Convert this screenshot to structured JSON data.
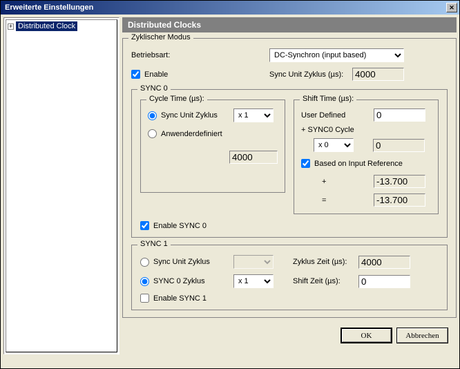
{
  "window": {
    "title": "Erweiterte Einstellungen",
    "close": "✕"
  },
  "tree": {
    "item": "Distributed Clock"
  },
  "header": "Distributed Clocks",
  "zyklisch": {
    "title": "Zyklischer Modus",
    "betriebsart_label": "Betriebsart:",
    "betriebsart_value": "DC-Synchron (input based)",
    "enable_label": "Enable",
    "sync_unit_label": "Sync Unit Zyklus (µs):",
    "sync_unit_value": "4000"
  },
  "sync0": {
    "title": "SYNC 0",
    "cycle_time": {
      "title": "Cycle Time (µs):",
      "radio_sync_unit": "Sync Unit Zyklus",
      "mult": "x 1",
      "radio_user": "Anwenderdefiniert",
      "value": "4000"
    },
    "shift_time": {
      "title": "Shift Time (µs):",
      "user_defined": "User Defined",
      "user_defined_val": "0",
      "plus_sync0": "+ SYNC0 Cycle",
      "mult": "x 0",
      "mult_val": "0",
      "based_on": "Based on Input Reference",
      "plus": "+",
      "plus_val": "-13.700",
      "eq": "=",
      "eq_val": "-13.700"
    },
    "enable_label": "Enable SYNC 0"
  },
  "sync1": {
    "title": "SYNC 1",
    "radio_sync_unit": "Sync Unit Zyklus",
    "radio_sync0": "SYNC 0 Zyklus",
    "mult": "x 1",
    "zyklus_label": "Zyklus Zeit (µs):",
    "zyklus_val": "4000",
    "shift_label": "Shift Zeit (µs):",
    "shift_val": "0",
    "enable_label": "Enable SYNC 1"
  },
  "buttons": {
    "ok": "OK",
    "cancel": "Abbrechen"
  }
}
